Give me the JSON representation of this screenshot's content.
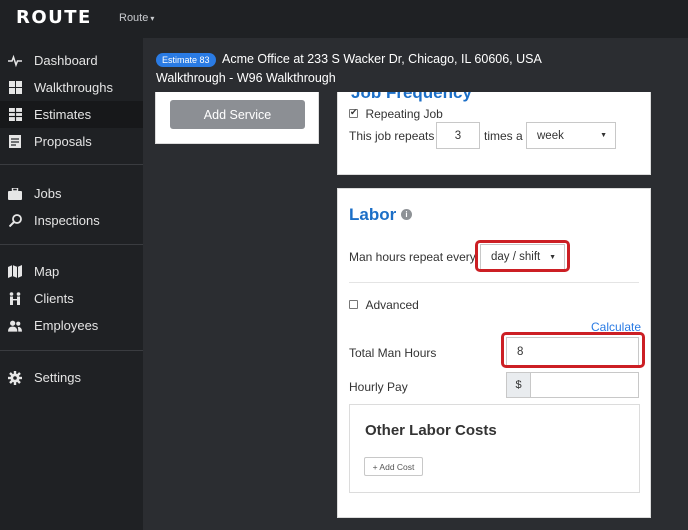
{
  "app": {
    "logo": "ROUTE",
    "org_dropdown": "Route",
    "caret": "▾"
  },
  "sidebar": {
    "items": [
      {
        "label": "Dashboard",
        "icon": "pulse-icon"
      },
      {
        "label": "Walkthroughs",
        "icon": "grid-icon"
      },
      {
        "label": "Estimates",
        "icon": "table-icon",
        "active": true
      },
      {
        "label": "Proposals",
        "icon": "document-icon"
      },
      {
        "label": "Jobs",
        "icon": "briefcase-icon"
      },
      {
        "label": "Inspections",
        "icon": "magnifier-icon"
      },
      {
        "label": "Map",
        "icon": "map-icon"
      },
      {
        "label": "Clients",
        "icon": "people-pair-icon"
      },
      {
        "label": "Employees",
        "icon": "users-icon"
      },
      {
        "label": "Settings",
        "icon": "gear-icon"
      }
    ]
  },
  "header": {
    "badge": "Estimate 83",
    "title": "Acme Office at 233 S Wacker Dr, Chicago, IL 60606, USA",
    "subtitle": "Walkthrough - W96 Walkthrough"
  },
  "services_card": {
    "add_service_label": "Add Service"
  },
  "frequency_card": {
    "heading_partial": "Job Frequency",
    "repeating_label": "Repeating Job",
    "repeating_checked": true,
    "repeats_label": "This job repeats",
    "repeats_value": "3",
    "times_label": "times a",
    "period_value": "week"
  },
  "labor_card": {
    "heading": "Labor",
    "info_glyph": "i",
    "man_hours_repeat_label": "Man hours repeat every",
    "man_hours_repeat_value": "day / shift",
    "advanced_label": "Advanced",
    "advanced_checked": false,
    "calculate_label": "Calculate",
    "total_man_hours_label": "Total Man Hours",
    "total_man_hours_value": "8",
    "hourly_pay_label": "Hourly Pay",
    "hourly_pay_prefix": "$",
    "hourly_pay_value": "",
    "other_costs_heading": "Other Labor Costs",
    "add_cost_label": "+ Add Cost"
  },
  "colors": {
    "accent": "#2a7be4",
    "heading_blue": "#1c6fc7",
    "highlight_red": "#cc1f24",
    "sidebar_bg": "#1f2124",
    "content_bg": "#2b2d31"
  }
}
